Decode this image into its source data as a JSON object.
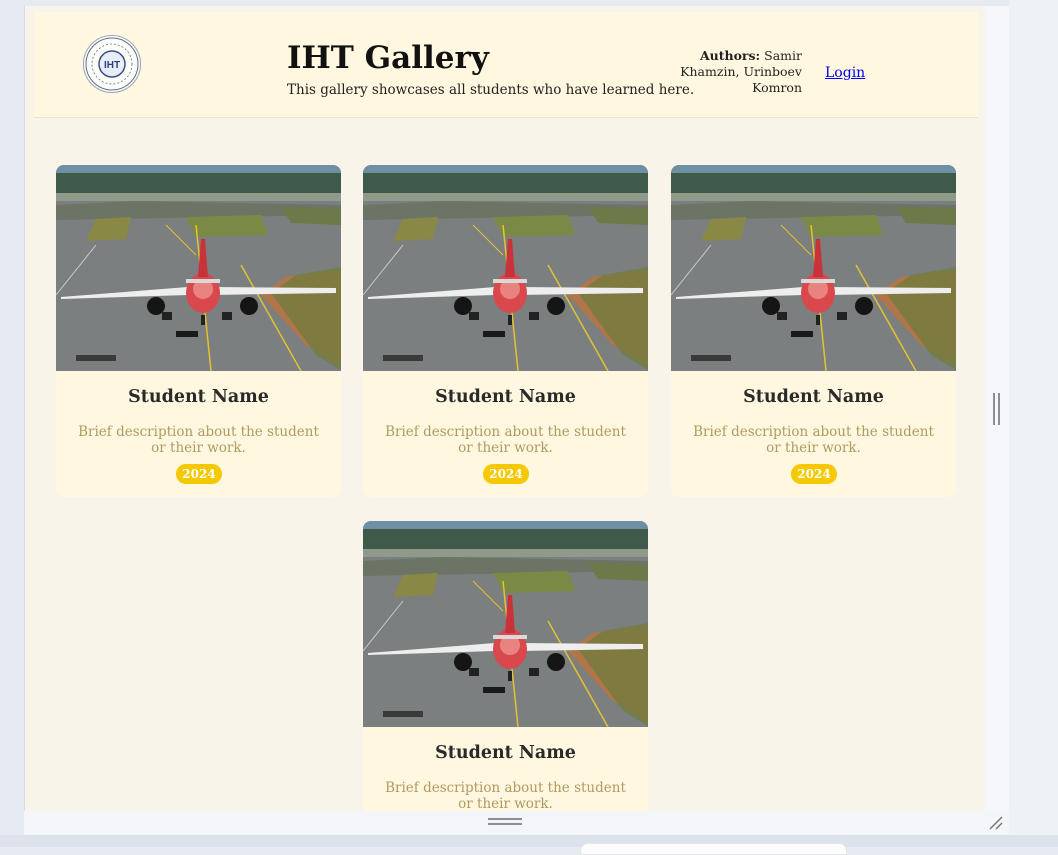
{
  "header": {
    "title": "IHT Gallery",
    "subtitle": "This gallery showcases all students who have learned here.",
    "authors_label": "Authors:",
    "authors_names": "Samir Khamzin, Urinboev Komron",
    "login_label": "Login"
  },
  "cards": [
    {
      "name": "Student Name",
      "description": "Brief description about the student or their work.",
      "year": "2024"
    },
    {
      "name": "Student Name",
      "description": "Brief description about the student or their work.",
      "year": "2024"
    },
    {
      "name": "Student Name",
      "description": "Brief description about the student or their work.",
      "year": "2024"
    },
    {
      "name": "Student Name",
      "description": "Brief description about the student or their work."
    }
  ],
  "colors": {
    "header_bg": "#fff7e0",
    "page_bg": "#f8f4ea",
    "badge": "#f5c800",
    "description_text": "#b09a5e",
    "link": "#0000ee"
  },
  "icons": {
    "logo": "iht-logo-seal",
    "card_image": "airplane-on-runway-photo"
  }
}
